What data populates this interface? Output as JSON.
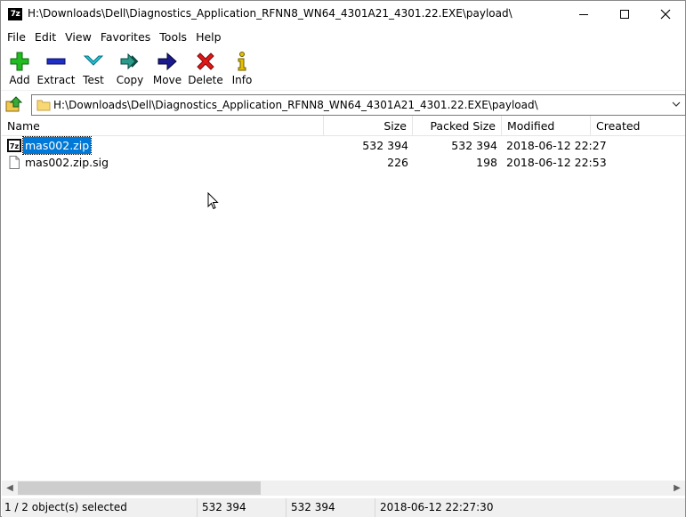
{
  "window": {
    "title": "H:\\Downloads\\Dell\\Diagnostics_Application_RFNN8_WN64_4301A21_4301.22.EXE\\payload\\",
    "app_icon": "7z",
    "controls": [
      "minimize",
      "maximize",
      "close"
    ]
  },
  "menu": {
    "items": [
      {
        "label": "File"
      },
      {
        "label": "Edit"
      },
      {
        "label": "View"
      },
      {
        "label": "Favorites"
      },
      {
        "label": "Tools"
      },
      {
        "label": "Help"
      }
    ]
  },
  "toolbar": {
    "buttons": [
      {
        "label": "Add",
        "icon": "plus-icon",
        "color": "#22aa22"
      },
      {
        "label": "Extract",
        "icon": "minus-icon",
        "color": "#1f2fb5"
      },
      {
        "label": "Test",
        "icon": "check-arrow-icon",
        "color": "#18b6c9"
      },
      {
        "label": "Copy",
        "icon": "double-arrow-icon",
        "color": "#2a8a7a"
      },
      {
        "label": "Move",
        "icon": "arrow-right-icon",
        "color": "#1a1a8c"
      },
      {
        "label": "Delete",
        "icon": "x-icon",
        "color": "#d01010"
      },
      {
        "label": "Info",
        "icon": "info-icon",
        "color": "#c8a800"
      }
    ]
  },
  "address": {
    "path": "H:\\Downloads\\Dell\\Diagnostics_Application_RFNN8_WN64_4301A21_4301.22.EXE\\payload\\"
  },
  "list": {
    "columns": [
      "Name",
      "Size",
      "Packed Size",
      "Modified",
      "Created"
    ],
    "rows": [
      {
        "name": "mas002.zip",
        "size": "532 394",
        "packed": "532 394",
        "modified": "2018-06-12 22:27",
        "created": "",
        "icon": "7z-archive-icon",
        "selected": true
      },
      {
        "name": "mas002.zip.sig",
        "size": "226",
        "packed": "198",
        "modified": "2018-06-12 22:53",
        "created": "",
        "icon": "file-icon",
        "selected": false
      }
    ]
  },
  "status": {
    "selection": "1 / 2 object(s) selected",
    "size": "532 394",
    "packed": "532 394",
    "modified": "2018-06-12 22:27:30"
  }
}
